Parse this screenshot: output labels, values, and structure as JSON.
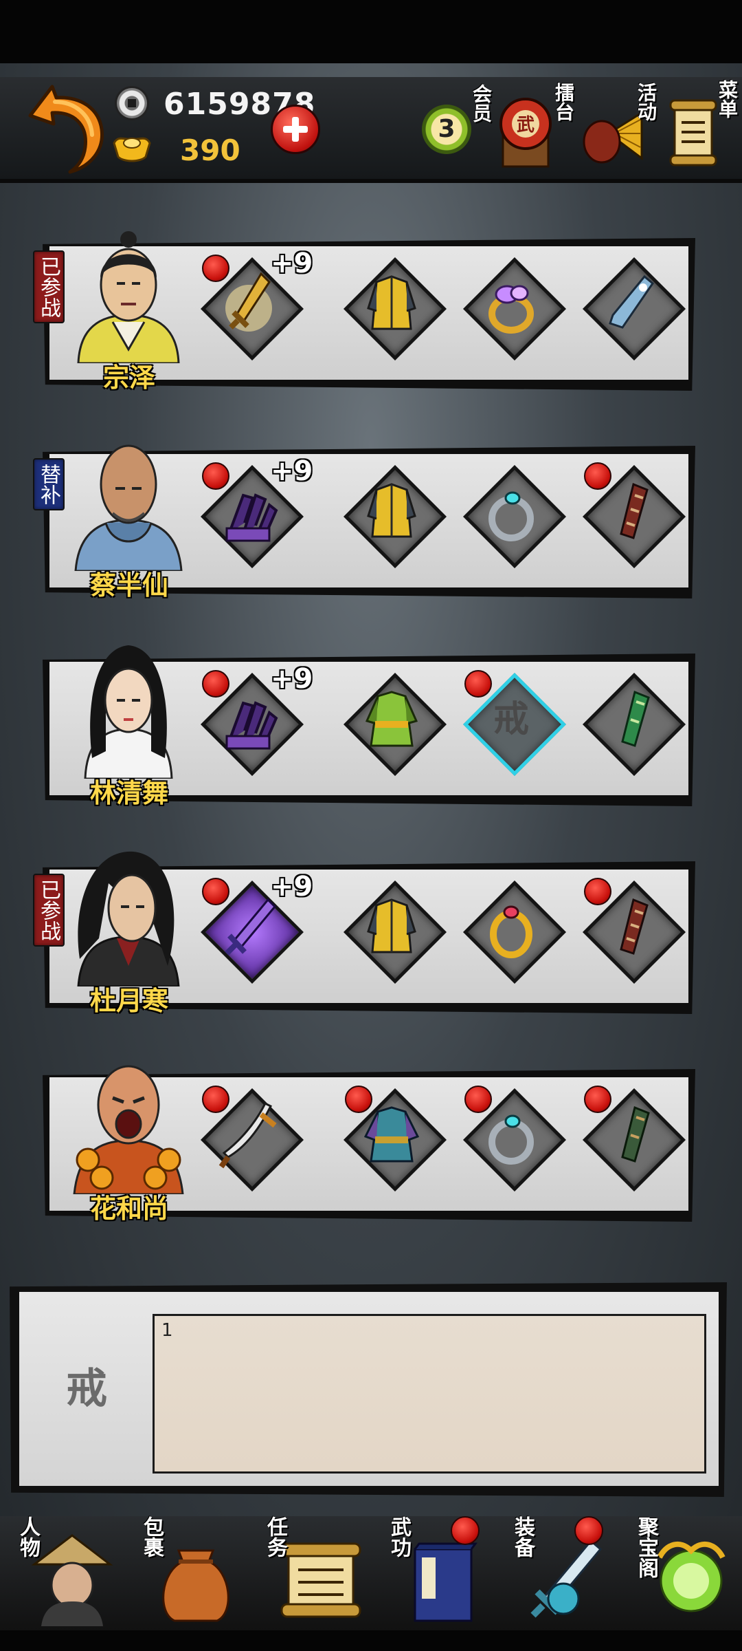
{
  "currency": {
    "coins": "6159878",
    "gold": "390"
  },
  "top_menu": [
    {
      "label": "会员",
      "icon": "vip-badge-icon",
      "badge": "3"
    },
    {
      "label": "擂台",
      "icon": "war-drum-icon"
    },
    {
      "label": "活动",
      "icon": "fan-bag-icon"
    },
    {
      "label": "菜单",
      "icon": "scroll-icon"
    }
  ],
  "heroes": [
    {
      "name": "宗泽",
      "status": "已参战",
      "status_color": "#8c1b1b",
      "slots": [
        {
          "icon": "golden-sword-icon",
          "level": "+9",
          "dot": true
        },
        {
          "icon": "armor-icon",
          "dot": false
        },
        {
          "icon": "gem-ring-icon",
          "dot": false
        },
        {
          "icon": "blue-boot-icon",
          "dot": false
        }
      ]
    },
    {
      "name": "蔡半仙",
      "status": "替补",
      "status_color": "#1d2f7a",
      "slots": [
        {
          "icon": "purple-claw-icon",
          "level": "+9",
          "dot": true
        },
        {
          "icon": "armor-icon",
          "dot": false
        },
        {
          "icon": "silver-ring-icon",
          "dot": false
        },
        {
          "icon": "bracer-icon",
          "dot": true
        }
      ]
    },
    {
      "name": "林清舞",
      "status": "",
      "slots": [
        {
          "icon": "purple-claw-icon",
          "level": "+9",
          "dot": true
        },
        {
          "icon": "green-robe-icon",
          "dot": false
        },
        {
          "icon": "empty-ring-slot-icon",
          "glyph": "戒",
          "dot": true
        },
        {
          "icon": "green-bracer-icon",
          "dot": false
        }
      ]
    },
    {
      "name": "杜月寒",
      "status": "已参战",
      "status_color": "#8c1b1b",
      "slots": [
        {
          "icon": "purple-sword-icon",
          "level": "+9",
          "dot": true
        },
        {
          "icon": "armor-icon",
          "dot": false
        },
        {
          "icon": "gold-ring-icon",
          "dot": false
        },
        {
          "icon": "bracer-icon",
          "dot": true
        }
      ]
    },
    {
      "name": "花和尚",
      "status": "",
      "slots": [
        {
          "icon": "saber-icon",
          "dot": true
        },
        {
          "icon": "blue-robe-icon",
          "dot": true
        },
        {
          "icon": "silver-ring-icon",
          "dot": true
        },
        {
          "icon": "green-bracer-icon",
          "dot": true
        }
      ]
    }
  ],
  "detail": {
    "glyph": "戒",
    "text": "1"
  },
  "bottom_nav": [
    {
      "label": "人物",
      "icon": "hat-hero-icon",
      "dot": false
    },
    {
      "label": "包裹",
      "icon": "bag-icon",
      "dot": false
    },
    {
      "label": "任务",
      "icon": "scroll-icon",
      "dot": false
    },
    {
      "label": "武功",
      "icon": "book-icon",
      "dot": true
    },
    {
      "label": "装备",
      "icon": "sword-equip-icon",
      "dot": true
    },
    {
      "label": "聚宝阁",
      "icon": "treasure-icon",
      "dot": false
    }
  ]
}
